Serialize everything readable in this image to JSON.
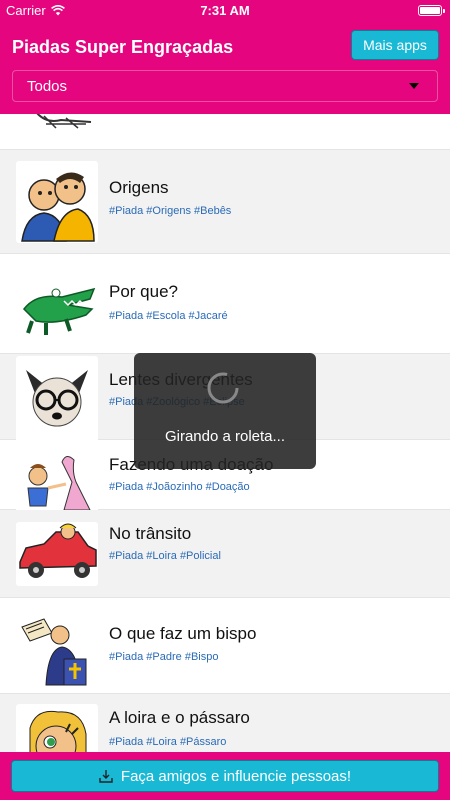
{
  "status_bar": {
    "carrier": "Carrier",
    "time": "7:31 AM"
  },
  "header": {
    "title": "Piadas Super Engraçadas",
    "more_apps_label": "Mais apps",
    "filter_value": "Todos"
  },
  "jokes": [
    {
      "title": "Origens",
      "tags": "#Piada #Origens #Bebês"
    },
    {
      "title": "Por que?",
      "tags": "#Piada #Escola #Jacaré"
    },
    {
      "title": "Lentes divergentes",
      "tags": "#Piada #Zoológico #Eclipse"
    },
    {
      "title": "Fazendo uma doação",
      "tags": "#Piada #Joãozinho #Doação"
    },
    {
      "title": "No trânsito",
      "tags": "#Piada #Loira #Policial"
    },
    {
      "title": "O que faz um bispo",
      "tags": "#Piada #Padre #Bispo"
    },
    {
      "title": "A loira e o pássaro",
      "tags": "#Piada #Loira #Pássaro"
    }
  ],
  "loading": {
    "message": "Girando a roleta..."
  },
  "bottom": {
    "share_label": "Faça amigos e influencie pessoas!"
  },
  "colors": {
    "brand": "#e5067f",
    "button": "#19b9d6",
    "tag": "#2a6bb7"
  }
}
